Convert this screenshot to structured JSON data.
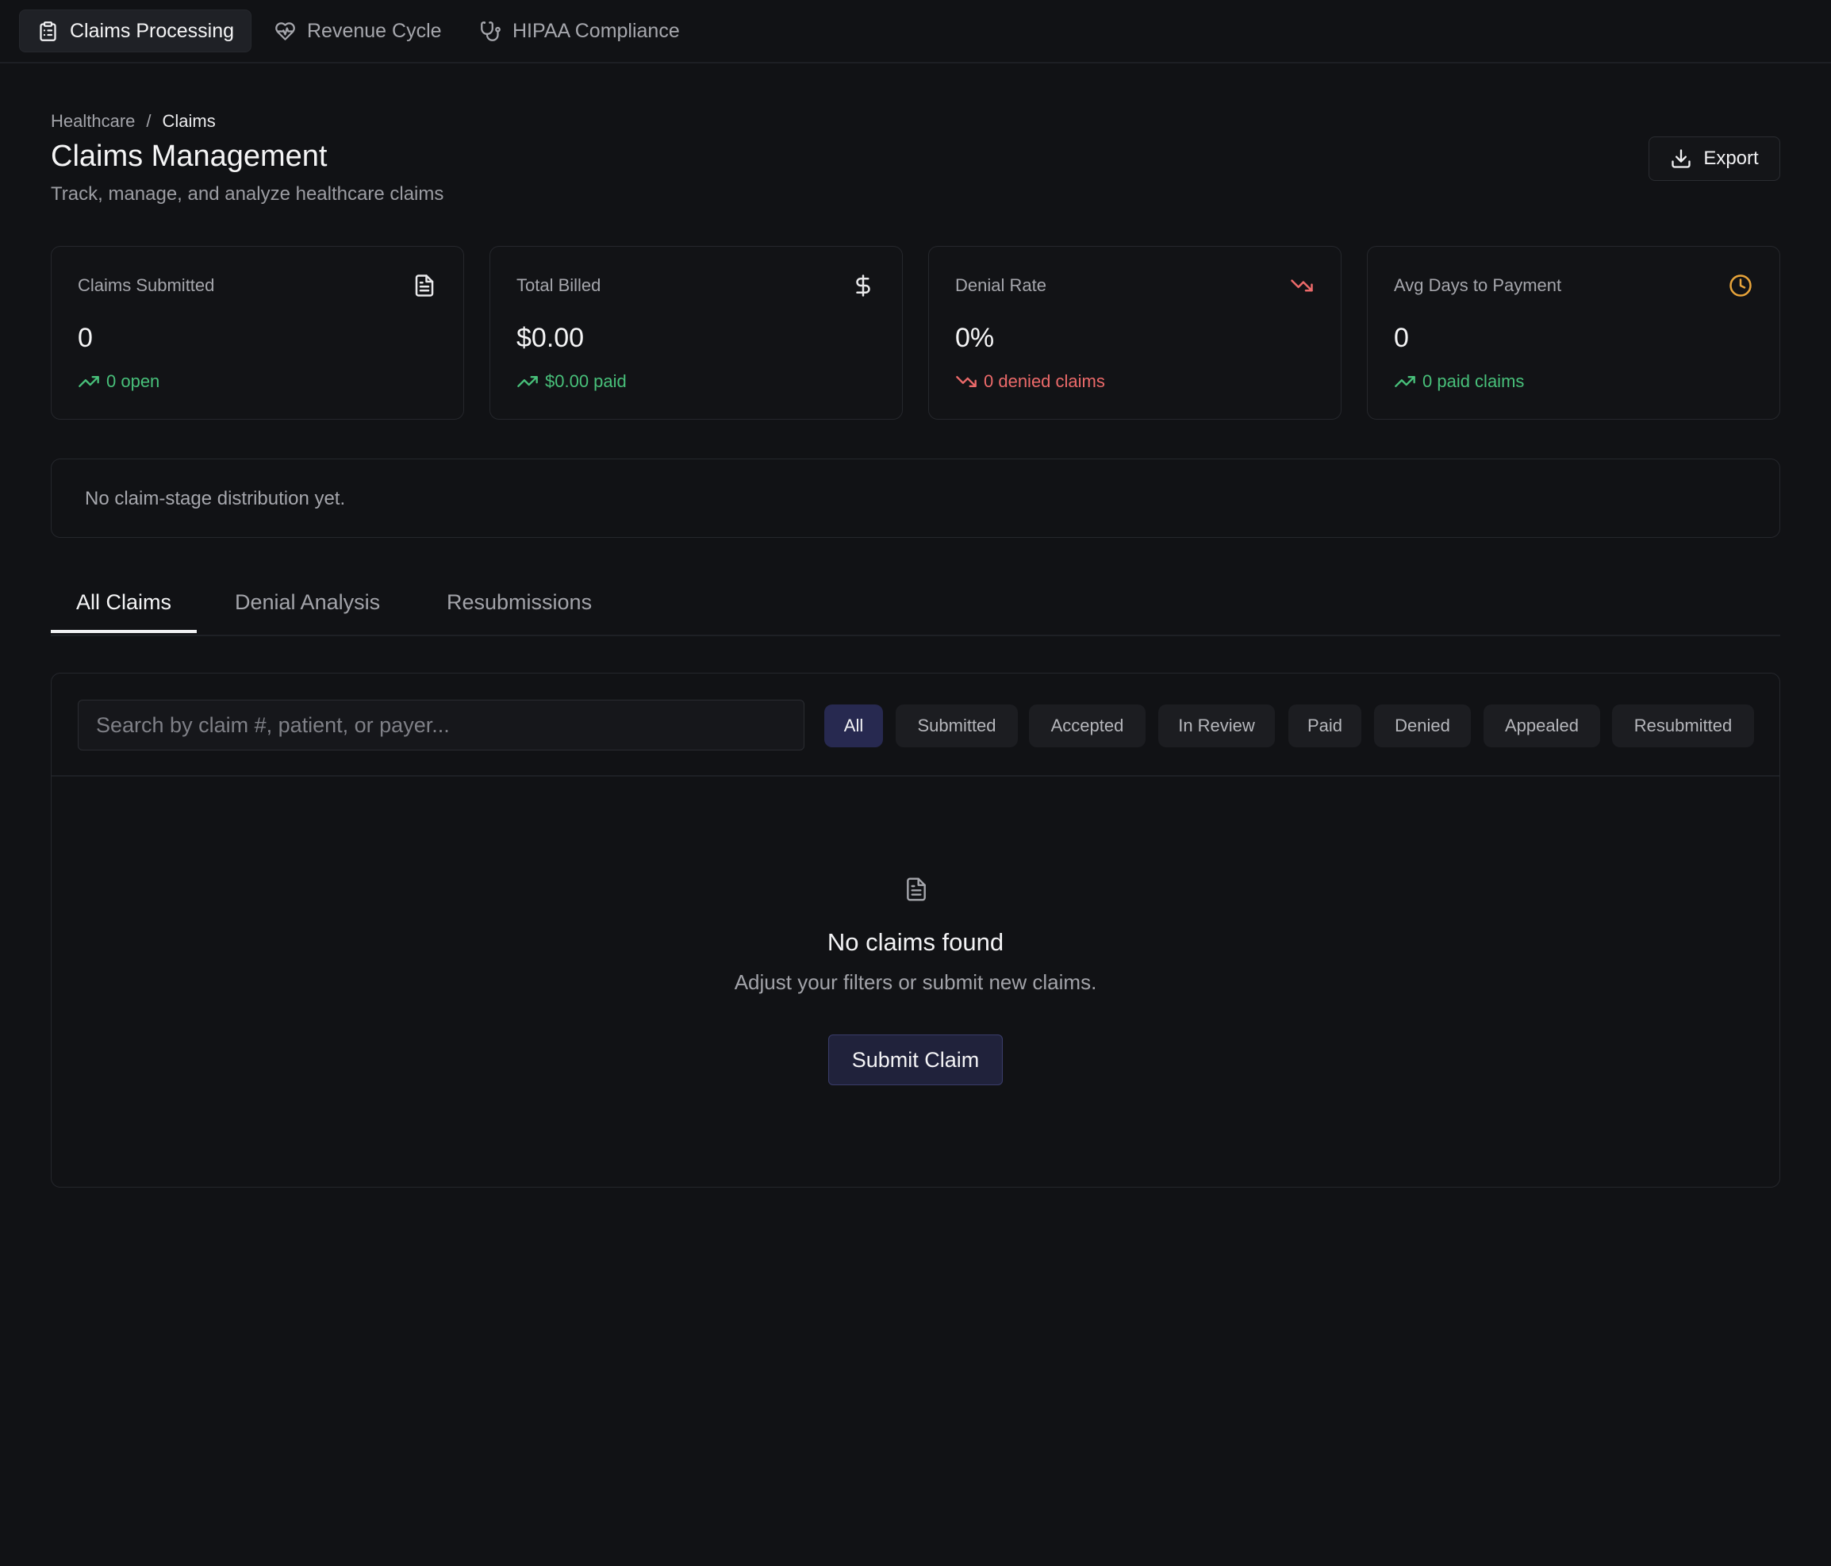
{
  "nav": {
    "tabs": [
      {
        "label": "Claims Processing",
        "icon": "clipboard-icon"
      },
      {
        "label": "Revenue Cycle",
        "icon": "heart-pulse-icon"
      },
      {
        "label": "HIPAA Compliance",
        "icon": "stethoscope-icon"
      }
    ]
  },
  "breadcrumb": {
    "parent": "Healthcare",
    "separator": "/",
    "current": "Claims"
  },
  "header": {
    "title": "Claims Management",
    "subtitle": "Track, manage, and analyze healthcare claims",
    "export_label": "Export"
  },
  "stats": [
    {
      "label": "Claims Submitted",
      "value": "0",
      "trend": "0 open",
      "trend_color": "#48c07a",
      "icon": "file-text-icon"
    },
    {
      "label": "Total Billed",
      "value": "$0.00",
      "trend": "$0.00 paid",
      "trend_color": "#48c07a",
      "icon": "dollar-icon"
    },
    {
      "label": "Denial Rate",
      "value": "0%",
      "trend": "0 denied claims",
      "trend_color": "#ec6a6a",
      "icon": "trending-down-icon"
    },
    {
      "label": "Avg Days to Payment",
      "value": "0",
      "trend": "0 paid claims",
      "trend_color": "#48c07a",
      "icon": "clock-icon"
    }
  ],
  "distribution": {
    "empty_text": "No claim-stage distribution yet."
  },
  "tabs": [
    "All Claims",
    "Denial Analysis",
    "Resubmissions"
  ],
  "filters": {
    "search_placeholder": "Search by claim #, patient, or payer...",
    "chips": [
      "All",
      "Submitted",
      "Accepted",
      "In Review",
      "Paid",
      "Denied",
      "Appealed",
      "Resubmitted"
    ],
    "active_chip": "All"
  },
  "empty_state": {
    "title": "No claims found",
    "subtitle": "Adjust your filters or submit new claims.",
    "button_label": "Submit Claim"
  },
  "colors": {
    "accent": "#272950",
    "positive": "#48c07a",
    "negative": "#ec6a6a",
    "warning": "#e8a43a"
  }
}
